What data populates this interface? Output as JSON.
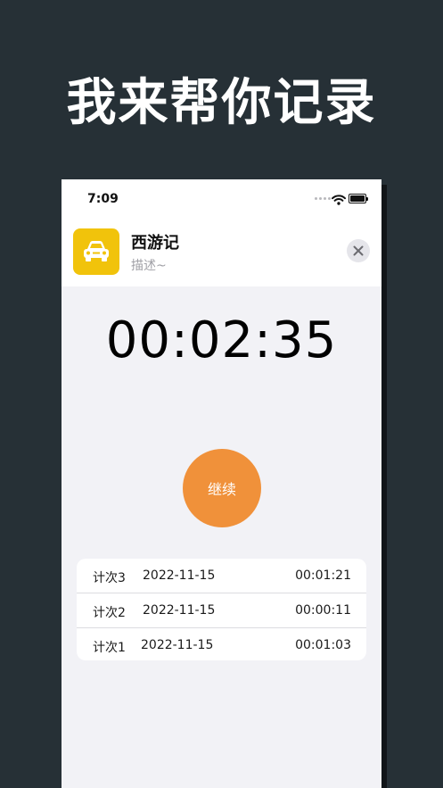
{
  "theme": {
    "background": "#263036",
    "accent": "#f0913a",
    "icon_bg": "#f1c30b"
  },
  "promo": {
    "headline": "我来帮你记录"
  },
  "status_bar": {
    "time": "7:09"
  },
  "header": {
    "title": "西游记",
    "subtitle": "描述~",
    "app_icon": "car-icon"
  },
  "timer": {
    "display": "00:02:35"
  },
  "controls": {
    "resume_label": "继续"
  },
  "laps": [
    {
      "name": "计次3",
      "date": "2022-11-15",
      "time": "00:01:21"
    },
    {
      "name": "计次2",
      "date": "2022-11-15",
      "time": "00:00:11"
    },
    {
      "name": "计次1",
      "date": "2022-11-15",
      "time": "00:01:03"
    }
  ]
}
